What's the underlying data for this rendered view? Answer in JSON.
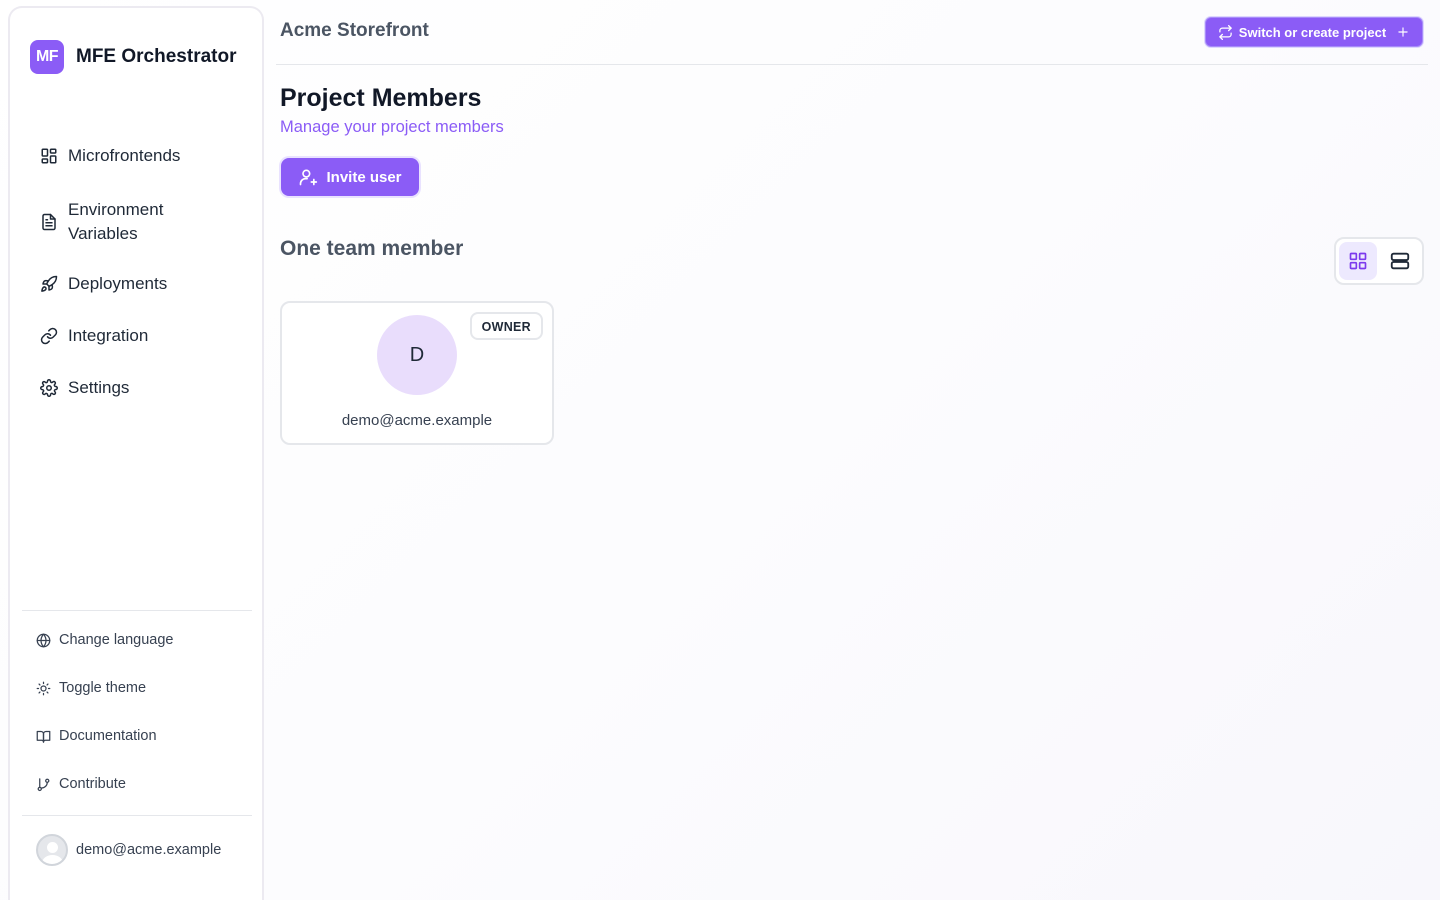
{
  "brand": {
    "logo_text": "MF",
    "name": "MFE Orchestrator"
  },
  "sidebar": {
    "nav": [
      {
        "label": "Microfrontends",
        "icon": "grid-icon"
      },
      {
        "label": "Environment Variables",
        "icon": "file-text-icon"
      },
      {
        "label": "Deployments",
        "icon": "rocket-icon"
      },
      {
        "label": "Integration",
        "icon": "link-icon"
      },
      {
        "label": "Settings",
        "icon": "gear-icon"
      }
    ],
    "utilities": [
      {
        "label": "Change language",
        "icon": "globe-icon"
      },
      {
        "label": "Toggle theme",
        "icon": "sun-icon"
      },
      {
        "label": "Documentation",
        "icon": "book-icon"
      },
      {
        "label": "Contribute",
        "icon": "git-branch-icon"
      }
    ],
    "user": {
      "email": "demo@acme.example"
    }
  },
  "header": {
    "project_name": "Acme Storefront",
    "switch_label": "Switch or create project"
  },
  "main": {
    "title": "Project Members",
    "subtitle": "Manage your project members",
    "invite_label": "Invite user",
    "section_title": "One team member",
    "view_mode": "grid",
    "members": [
      {
        "initial": "D",
        "email": "demo@acme.example",
        "role": "OWNER"
      }
    ]
  },
  "colors": {
    "accent": "#8b5cf6",
    "avatar_bg": "#e9ddfc",
    "active_toggle_bg": "#ede9fe"
  }
}
